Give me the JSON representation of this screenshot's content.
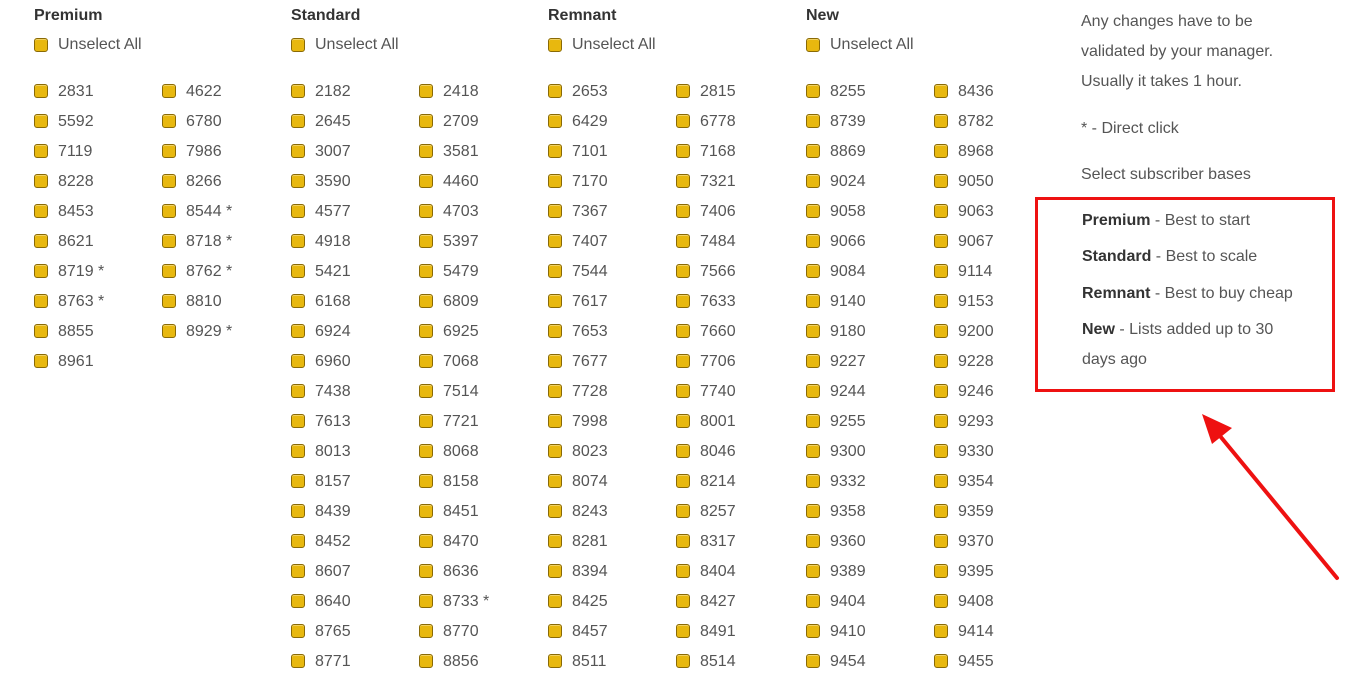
{
  "groups": [
    {
      "title": "Premium",
      "unselect": "Unselect All",
      "col1": [
        "2831",
        "5592",
        "7119",
        "8228",
        "8453",
        "8621",
        "8719 *",
        "8763 *",
        "8855",
        "8961"
      ],
      "col2": [
        "4622",
        "6780",
        "7986",
        "8266",
        "8544 *",
        "8718 *",
        "8762 *",
        "8810",
        "8929 *"
      ]
    },
    {
      "title": "Standard",
      "unselect": "Unselect All",
      "col1": [
        "2182",
        "2645",
        "3007",
        "3590",
        "4577",
        "4918",
        "5421",
        "6168",
        "6924",
        "6960",
        "7438",
        "7613",
        "8013",
        "8157",
        "8439",
        "8452",
        "8607",
        "8640",
        "8765",
        "8771"
      ],
      "col2": [
        "2418",
        "2709",
        "3581",
        "4460",
        "4703",
        "5397",
        "5479",
        "6809",
        "6925",
        "7068",
        "7514",
        "7721",
        "8068",
        "8158",
        "8451",
        "8470",
        "8636",
        "8733 *",
        "8770",
        "8856"
      ]
    },
    {
      "title": "Remnant",
      "unselect": "Unselect All",
      "col1": [
        "2653",
        "6429",
        "7101",
        "7170",
        "7367",
        "7407",
        "7544",
        "7617",
        "7653",
        "7677",
        "7728",
        "7998",
        "8023",
        "8074",
        "8243",
        "8281",
        "8394",
        "8425",
        "8457",
        "8511"
      ],
      "col2": [
        "2815",
        "6778",
        "7168",
        "7321",
        "7406",
        "7484",
        "7566",
        "7633",
        "7660",
        "7706",
        "7740",
        "8001",
        "8046",
        "8214",
        "8257",
        "8317",
        "8404",
        "8427",
        "8491",
        "8514"
      ]
    },
    {
      "title": "New",
      "unselect": "Unselect All",
      "col1": [
        "8255",
        "8739",
        "8869",
        "9024",
        "9058",
        "9066",
        "9084",
        "9140",
        "9180",
        "9227",
        "9244",
        "9255",
        "9300",
        "9332",
        "9358",
        "9360",
        "9389",
        "9404",
        "9410",
        "9454"
      ],
      "col2": [
        "8436",
        "8782",
        "8968",
        "9050",
        "9063",
        "9067",
        "9114",
        "9153",
        "9200",
        "9228",
        "9246",
        "9293",
        "9330",
        "9354",
        "9359",
        "9370",
        "9395",
        "9408",
        "9414",
        "9455"
      ]
    }
  ],
  "info": {
    "manager_line1": "Any changes have to be",
    "manager_line2": "validated by your manager.",
    "manager_line3": "Usually it takes 1 hour.",
    "direct_click": "* - Direct click",
    "select_bases": "Select subscriber bases"
  },
  "legend": [
    {
      "name": "Premium",
      "desc": " - Best to start"
    },
    {
      "name": "Standard",
      "desc": " - Best to scale"
    },
    {
      "name": "Remnant",
      "desc": " - Best to buy cheap"
    },
    {
      "name": "New",
      "desc": " - Lists added up to 30",
      "desc2": "days ago"
    }
  ],
  "colors": {
    "checkbox": "#e8b80f",
    "highlight": "#ee1111"
  }
}
